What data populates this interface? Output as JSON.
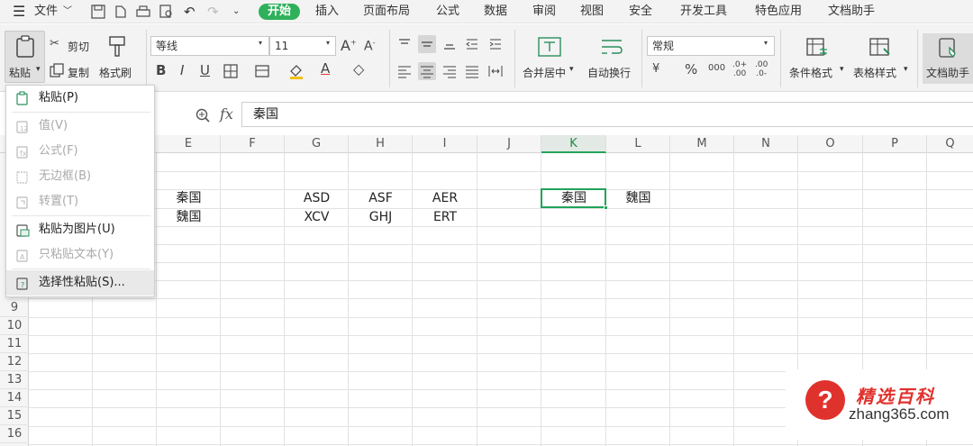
{
  "menubar": {
    "file_label": "文件",
    "tabs": [
      "开始",
      "插入",
      "页面布局",
      "公式",
      "数据",
      "审阅",
      "视图",
      "安全",
      "开发工具",
      "特色应用",
      "文档助手"
    ],
    "active_tab": "开始"
  },
  "ribbon": {
    "paste_label": "粘贴",
    "cut_label": "剪切",
    "copy_label": "复制",
    "format_painter_label": "格式刷",
    "font_name": "等线",
    "font_size": "11",
    "merge_center_label": "合并居中",
    "wrap_text_label": "自动换行",
    "number_format": "常规",
    "conditional_format_label": "条件格式",
    "table_style_label": "表格样式",
    "doc_assistant_label": "文档助手"
  },
  "formula_bar": {
    "fx_label": "fx",
    "value": "秦国"
  },
  "columns": [
    "E",
    "F",
    "G",
    "H",
    "I",
    "J",
    "K",
    "L",
    "M",
    "N",
    "O",
    "P",
    "Q"
  ],
  "active_column": "K",
  "rows": [
    "9",
    "10",
    "11",
    "12",
    "13",
    "14",
    "15",
    "16"
  ],
  "cells": {
    "E_r1": "秦国",
    "E_r2": "魏国",
    "G_r1": "ASD",
    "G_r2": "XCV",
    "H_r1": "ASF",
    "H_r2": "GHJ",
    "I_r1": "AER",
    "I_r2": "ERT",
    "K_r1": "秦国",
    "L_r1": "魏国"
  },
  "paste_menu": {
    "items": [
      {
        "label": "粘贴(P)",
        "enabled": true
      },
      {
        "label": "值(V)",
        "enabled": false
      },
      {
        "label": "公式(F)",
        "enabled": false
      },
      {
        "label": "无边框(B)",
        "enabled": false
      },
      {
        "label": "转置(T)",
        "enabled": false
      },
      {
        "label": "粘贴为图片(U)",
        "enabled": true
      },
      {
        "label": "只粘贴文本(Y)",
        "enabled": false
      },
      {
        "label": "选择性粘贴(S)...",
        "enabled": true
      }
    ]
  },
  "watermark": {
    "brand": "精选百科",
    "url": "zhang365.com"
  },
  "colors": {
    "accent_green": "#2fb15b",
    "selection_green": "#21a35a",
    "watermark_red": "#e0322d"
  }
}
